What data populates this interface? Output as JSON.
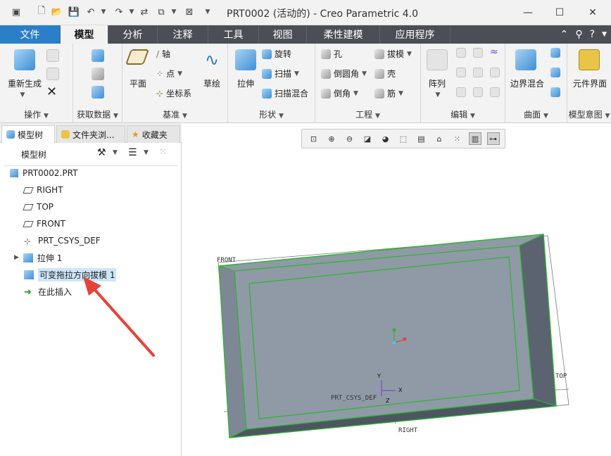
{
  "titlebar": {
    "title": "PRT0002 (活动的) - Creo Parametric 4.0",
    "minimize": "—",
    "maximize": "☐",
    "close": "✕"
  },
  "menu": {
    "tabs": [
      "文件",
      "模型",
      "分析",
      "注释",
      "工具",
      "视图",
      "柔性建模",
      "应用程序"
    ],
    "active": "模型"
  },
  "ribbon": {
    "groups": {
      "operations": {
        "label": "操作",
        "regenerate": "重新生成"
      },
      "getdata": {
        "label": "获取数据"
      },
      "datum": {
        "label": "基准",
        "plane": "平面",
        "axis": "轴",
        "point": "点",
        "csys": "坐标系",
        "sketch": "草绘"
      },
      "shapes": {
        "label": "形状",
        "extrude": "拉伸",
        "revolve": "旋转",
        "sweep": "扫描",
        "swept_blend": "扫描混合"
      },
      "engineering": {
        "label": "工程",
        "hole": "孔",
        "round": "倒圆角",
        "chamfer": "倒角",
        "draft": "拔模",
        "shell": "壳",
        "rib": "筋"
      },
      "edit": {
        "label": "编辑",
        "pattern": "阵列"
      },
      "surfaces": {
        "label": "曲面",
        "boundary_blend": "边界混合"
      },
      "intent": {
        "label": "模型意图",
        "component_interface": "元件界面"
      }
    }
  },
  "leftpanel": {
    "tabs": [
      "模型树",
      "文件夹浏...",
      "收藏夹"
    ],
    "tree_title": "模型树",
    "items": [
      {
        "label": "PRT0002.PRT"
      },
      {
        "label": "RIGHT"
      },
      {
        "label": "TOP"
      },
      {
        "label": "FRONT"
      },
      {
        "label": "PRT_CSYS_DEF"
      },
      {
        "label": "拉伸 1"
      },
      {
        "label": "可变拖拉方向拔模 1"
      },
      {
        "label": "在此插入"
      }
    ]
  },
  "viewport": {
    "labels": {
      "front": "FRONT",
      "top": "TOP",
      "right": "RIGHT",
      "csys": "PRT_CSYS_DEF",
      "x": "X",
      "y": "Y",
      "z": "Z"
    },
    "model_color": "#8f9aa6",
    "edge_color": "#2db52d"
  }
}
